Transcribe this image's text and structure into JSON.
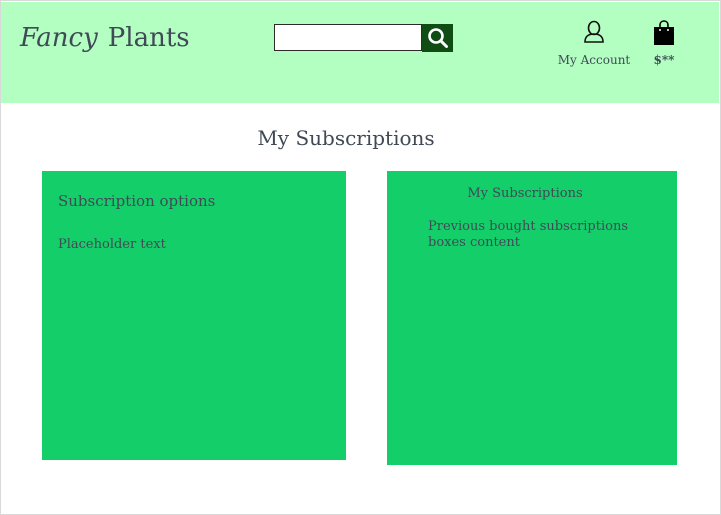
{
  "header": {
    "brand_fancy": "Fancy",
    "brand_plants": "Plants",
    "search": {
      "value": "",
      "placeholder": ""
    },
    "account_label": "My Account",
    "cart_label": "$**",
    "icons": {
      "search": "search-icon",
      "account": "user-icon",
      "cart": "shopping-bag-icon"
    }
  },
  "main": {
    "title": "My Subscriptions",
    "options_panel": {
      "heading": "Subscription options",
      "text": "Placeholder text"
    },
    "subscriptions_panel": {
      "heading": "My Subscriptions",
      "text": "Previous bought subscriptions boxes content"
    }
  },
  "colors": {
    "header_bg": "#b3ffc1",
    "panel_bg": "#14cf69",
    "search_button_bg": "#0f4d14",
    "text": "#3f4a56"
  }
}
